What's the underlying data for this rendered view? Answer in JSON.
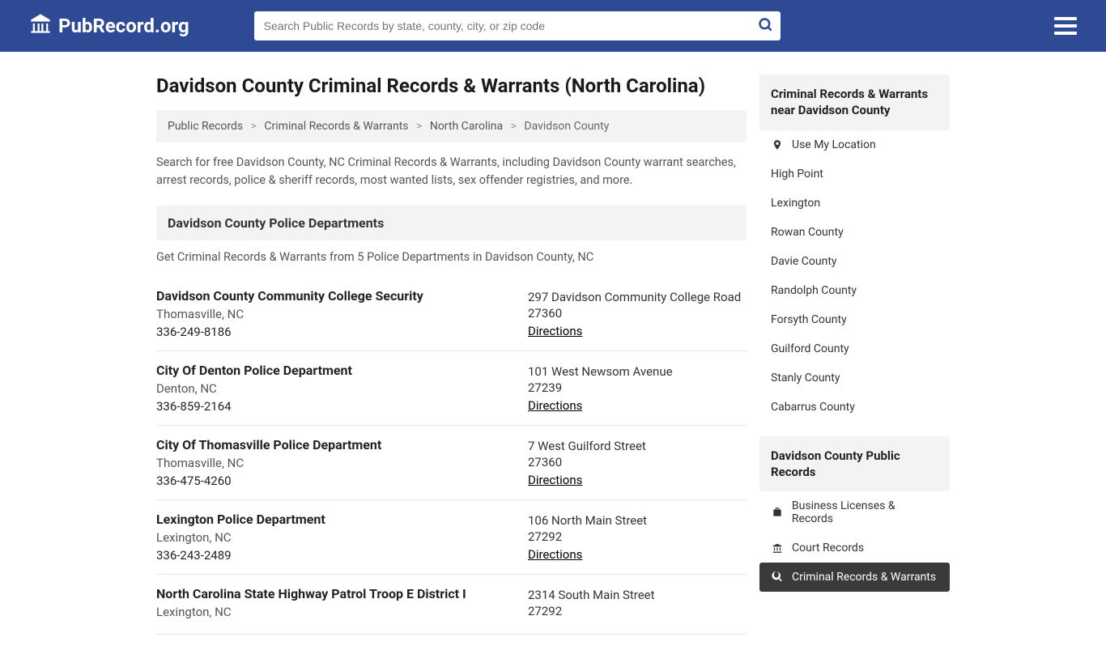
{
  "header": {
    "brand": "PubRecord.org",
    "search_placeholder": "Search Public Records by state, county, city, or zip code"
  },
  "page": {
    "title": "Davidson County Criminal Records & Warrants (North Carolina)",
    "breadcrumbs": [
      "Public Records",
      "Criminal Records & Warrants",
      "North Carolina",
      "Davidson County"
    ],
    "intro": "Search for free Davidson County, NC Criminal Records & Warrants, including Davidson County warrant searches, arrest records, police & sheriff records, most wanted lists, sex offender registries, and more."
  },
  "section": {
    "header": "Davidson County Police Departments",
    "sub": "Get Criminal Records & Warrants from 5 Police Departments in Davidson County, NC"
  },
  "departments": [
    {
      "name": "Davidson County Community College Security",
      "loc": "Thomasville, NC",
      "phone": "336-249-8186",
      "addr": "297 Davidson Community College Road",
      "zip": "27360",
      "directions": "Directions"
    },
    {
      "name": "City Of Denton Police Department",
      "loc": "Denton, NC",
      "phone": "336-859-2164",
      "addr": "101 West Newsom Avenue",
      "zip": "27239",
      "directions": "Directions"
    },
    {
      "name": "City Of Thomasville Police Department",
      "loc": "Thomasville, NC",
      "phone": "336-475-4260",
      "addr": "7 West Guilford Street",
      "zip": "27360",
      "directions": "Directions"
    },
    {
      "name": "Lexington Police Department",
      "loc": "Lexington, NC",
      "phone": "336-243-2489",
      "addr": "106 North Main Street",
      "zip": "27292",
      "directions": "Directions"
    },
    {
      "name": "North Carolina State Highway Patrol Troop E District I",
      "loc": "Lexington, NC",
      "phone": "",
      "addr": "2314 South Main Street",
      "zip": "27292",
      "directions": ""
    }
  ],
  "sidebar": {
    "near_header": "Criminal Records & Warrants near Davidson County",
    "use_location": "Use My Location",
    "near_items": [
      "High Point",
      "Lexington",
      "Rowan County",
      "Davie County",
      "Randolph County",
      "Forsyth County",
      "Guilford County",
      "Stanly County",
      "Cabarrus County"
    ],
    "public_header": "Davidson County Public Records",
    "public_items": [
      {
        "label": "Business Licenses & Records",
        "icon": "business",
        "active": false
      },
      {
        "label": "Court Records",
        "icon": "court",
        "active": false
      },
      {
        "label": "Criminal Records & Warrants",
        "icon": "criminal",
        "active": true
      }
    ]
  }
}
